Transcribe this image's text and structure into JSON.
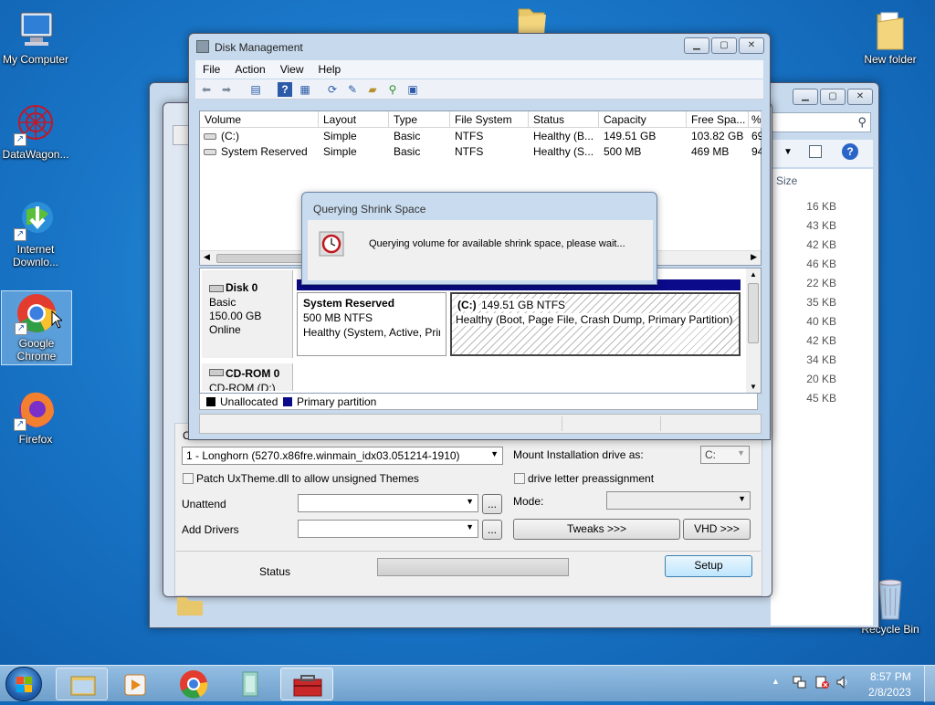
{
  "desktop": {
    "icons": [
      {
        "label": "My Computer",
        "icon": "computer-icon"
      },
      {
        "label": "DataWagon...",
        "icon": "datawagon-icon"
      },
      {
        "label": "Internet Downlo...",
        "icon": "internet-download-manager-icon"
      },
      {
        "label": "Google Chrome",
        "icon": "chrome-icon"
      },
      {
        "label": "Firefox",
        "icon": "firefox-icon"
      },
      {
        "label": "New folder",
        "icon": "folder-icon"
      },
      {
        "label": "Recycle Bin",
        "icon": "recycle-bin-icon"
      }
    ]
  },
  "explorer": {
    "size_header": "Size",
    "sizes": [
      "16 KB",
      "43 KB",
      "42 KB",
      "46 KB",
      "22 KB",
      "35 KB",
      "40 KB",
      "42 KB",
      "34 KB",
      "20 KB",
      "45 KB"
    ]
  },
  "setup_window": {
    "image_select": "1 - Longhorn  (5270.x86fre.winmain_idx03.051214-1910)",
    "patch_uxtheme_label": "Patch UxTheme.dll to allow unsigned Themes",
    "unattend_label": "Unattend",
    "unattend_value": "",
    "add_drivers_label": "Add Drivers",
    "add_drivers_value": "",
    "browse_label": "...",
    "mount_label": "Mount Installation drive as:",
    "mount_value": "C:",
    "drive_letter_label": "drive letter preassignment",
    "mode_label": "Mode:",
    "mode_value": "",
    "tweaks_label": "Tweaks >>>",
    "vhd_label": "VHD >>>",
    "status_label": "Status",
    "setup_label": "Setup",
    "progress": 0
  },
  "disk_mgmt": {
    "title": "Disk Management",
    "menu": [
      "File",
      "Action",
      "View",
      "Help"
    ],
    "columns": [
      "Volume",
      "Layout",
      "Type",
      "File System",
      "Status",
      "Capacity",
      "Free Spa...",
      "%"
    ],
    "volumes": [
      {
        "volume": "(C:)",
        "layout": "Simple",
        "type": "Basic",
        "fs": "NTFS",
        "status": "Healthy (B...",
        "capacity": "149.51 GB",
        "free": "103.82 GB",
        "pct": "69"
      },
      {
        "volume": "System Reserved",
        "layout": "Simple",
        "type": "Basic",
        "fs": "NTFS",
        "status": "Healthy (S...",
        "capacity": "500 MB",
        "free": "469 MB",
        "pct": "94"
      }
    ],
    "disk0": {
      "name": "Disk 0",
      "type": "Basic",
      "size": "150.00 GB",
      "state": "Online"
    },
    "partitions": [
      {
        "name": "System Reserved",
        "size": "500 MB NTFS",
        "status": "Healthy (System, Active, Prin"
      },
      {
        "name": "(C:)",
        "size": "149.51 GB NTFS",
        "status": "Healthy (Boot, Page File, Crash Dump, Primary Partition)"
      }
    ],
    "cdrom": {
      "name": "CD-ROM 0",
      "drive": "CD-ROM (D:)"
    },
    "legend": [
      {
        "label": "Unallocated",
        "color": "#000000"
      },
      {
        "label": "Primary partition",
        "color": "#0a0a8a"
      }
    ]
  },
  "dialog": {
    "title": "Querying Shrink Space",
    "message": "Querying volume for available shrink space, please wait..."
  },
  "taskbar": {
    "time": "8:57 PM",
    "date": "2/8/2023"
  }
}
